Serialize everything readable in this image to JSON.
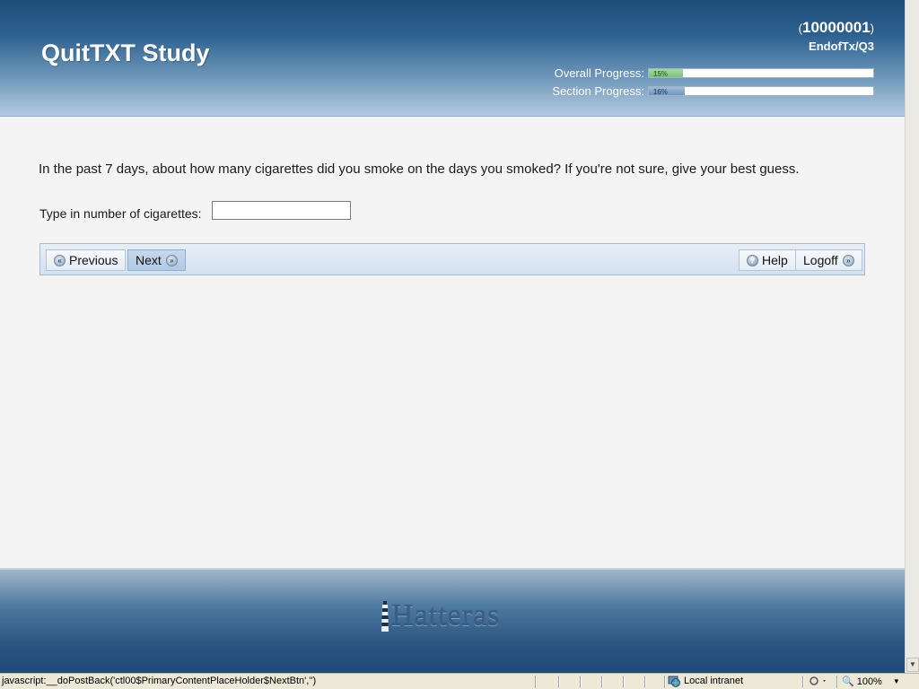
{
  "header": {
    "app_title": "QuitTXT Study",
    "participant_open": "(",
    "participant_id": "10000001",
    "participant_close": ")",
    "location": "EndofTx/Q3",
    "overall_progress": {
      "label": "Overall Progress:",
      "percent_text": "15%",
      "value": 15,
      "color": "#7ebf7b"
    },
    "section_progress": {
      "label": "Section Progress:",
      "percent_text": "16%",
      "value": 16,
      "color": "#6f96ba"
    }
  },
  "question": {
    "text": "In the past 7 days, about how many cigarettes did you smoke on the days you smoked? If you're not sure, give your best guess.",
    "answer_label": "Type in number of cigarettes:",
    "answer_value": ""
  },
  "nav": {
    "previous_label": "Previous",
    "next_label": "Next",
    "help_label": "Help",
    "logoff_label": "Logoff"
  },
  "footer": {
    "brand": "Hatteras"
  },
  "statusbar": {
    "text": "javascript:__doPostBack('ctl00$PrimaryContentPlaceHolder$NextBtn','')",
    "zone": "Local intranet",
    "zoom": "100%"
  },
  "icons": {
    "previous": "rewind-circle-icon",
    "next": "fast-forward-circle-icon",
    "help": "question-circle-icon",
    "logoff": "fast-forward-circle-icon",
    "zone": "globe-icon",
    "zoom": "magnifier-icon"
  }
}
